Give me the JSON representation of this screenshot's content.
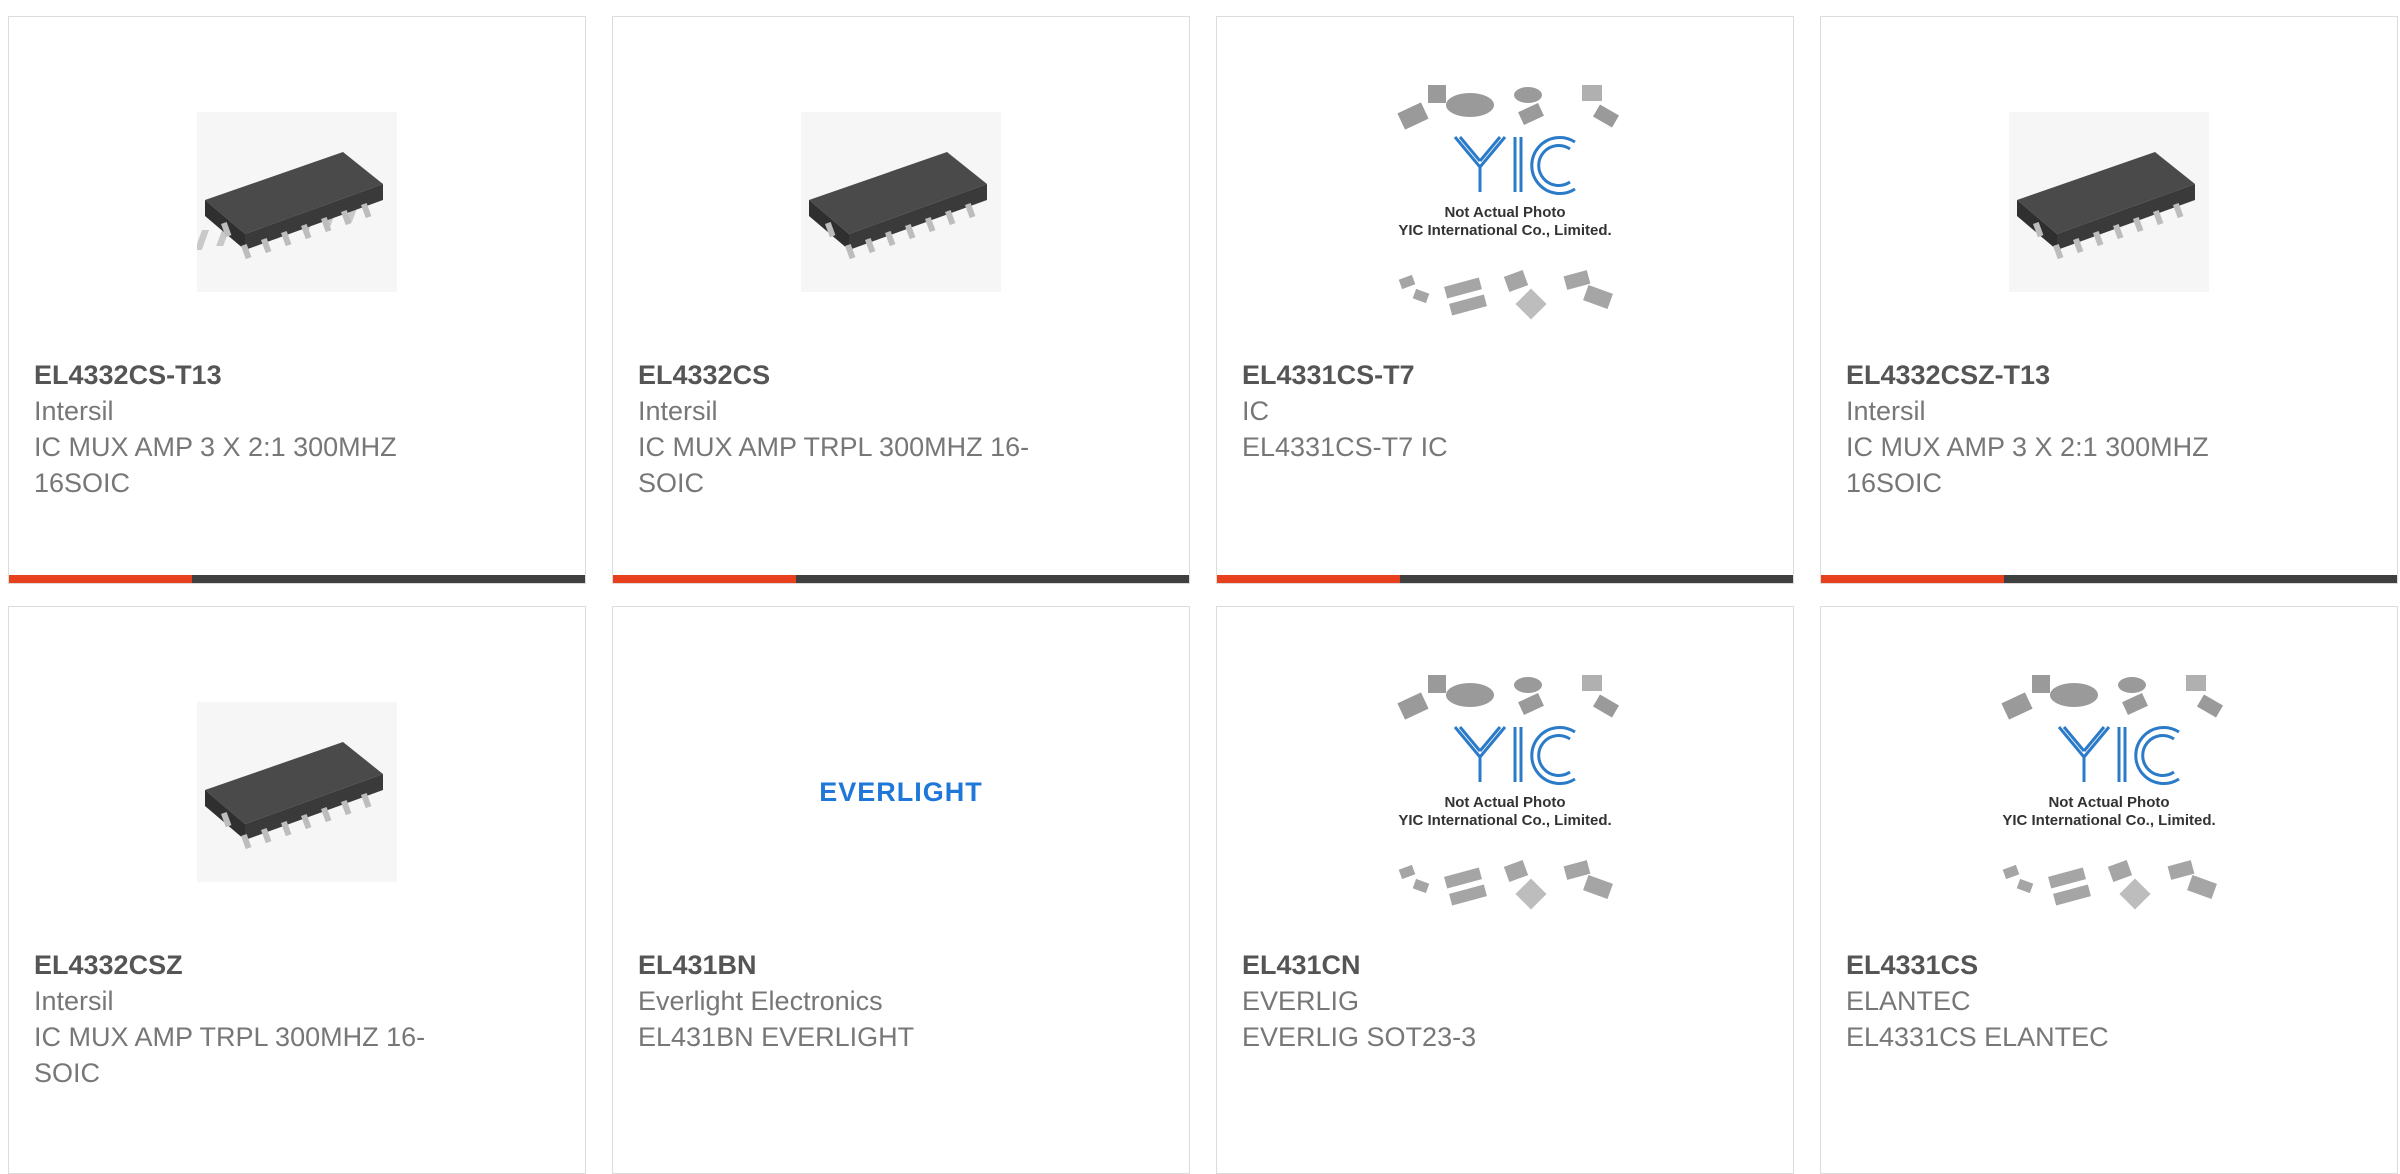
{
  "products": [
    {
      "part_no": "EL4332CS-T13",
      "maker": "Intersil",
      "desc": "IC MUX AMP 3 X 2:1 300MHZ 16SOIC",
      "image": "soic-chip-icon"
    },
    {
      "part_no": "EL4332CS",
      "maker": "Intersil",
      "desc": "IC MUX AMP TRPL 300MHZ 16-SOIC",
      "image": "soic-chip-icon"
    },
    {
      "part_no": "EL4331CS-T7",
      "maker": "IC",
      "desc": "EL4331CS-T7 IC",
      "image": "yic-placeholder-icon"
    },
    {
      "part_no": "EL4332CSZ-T13",
      "maker": "Intersil",
      "desc": "IC MUX AMP 3 X 2:1 300MHZ 16SOIC",
      "image": "soic-chip-icon"
    },
    {
      "part_no": "EL4332CSZ",
      "maker": "Intersil",
      "desc": "IC MUX AMP TRPL 300MHZ 16-SOIC",
      "image": "soic-chip-icon"
    },
    {
      "part_no": "EL431BN",
      "maker": "Everlight Electronics",
      "desc": "EL431BN EVERLIGHT",
      "image": "everlight-logo"
    },
    {
      "part_no": "EL431CN",
      "maker": "EVERLIG",
      "desc": "EVERLIG SOT23-3",
      "image": "yic-placeholder-icon"
    },
    {
      "part_no": "EL4331CS",
      "maker": "ELANTEC",
      "desc": "EL4331CS ELANTEC",
      "image": "yic-placeholder-icon"
    }
  ],
  "placeholder": {
    "logo_text": "YIC",
    "line1": "Not Actual Photo",
    "line2": "YIC International Co., Limited."
  },
  "everlight_logo_text": "EVERLIGHT",
  "colors": {
    "accent": "#e8401c",
    "bar": "#3f3f3f",
    "part_no": "#555555",
    "text": "#777777",
    "everlight_blue": "#1f78d8"
  }
}
